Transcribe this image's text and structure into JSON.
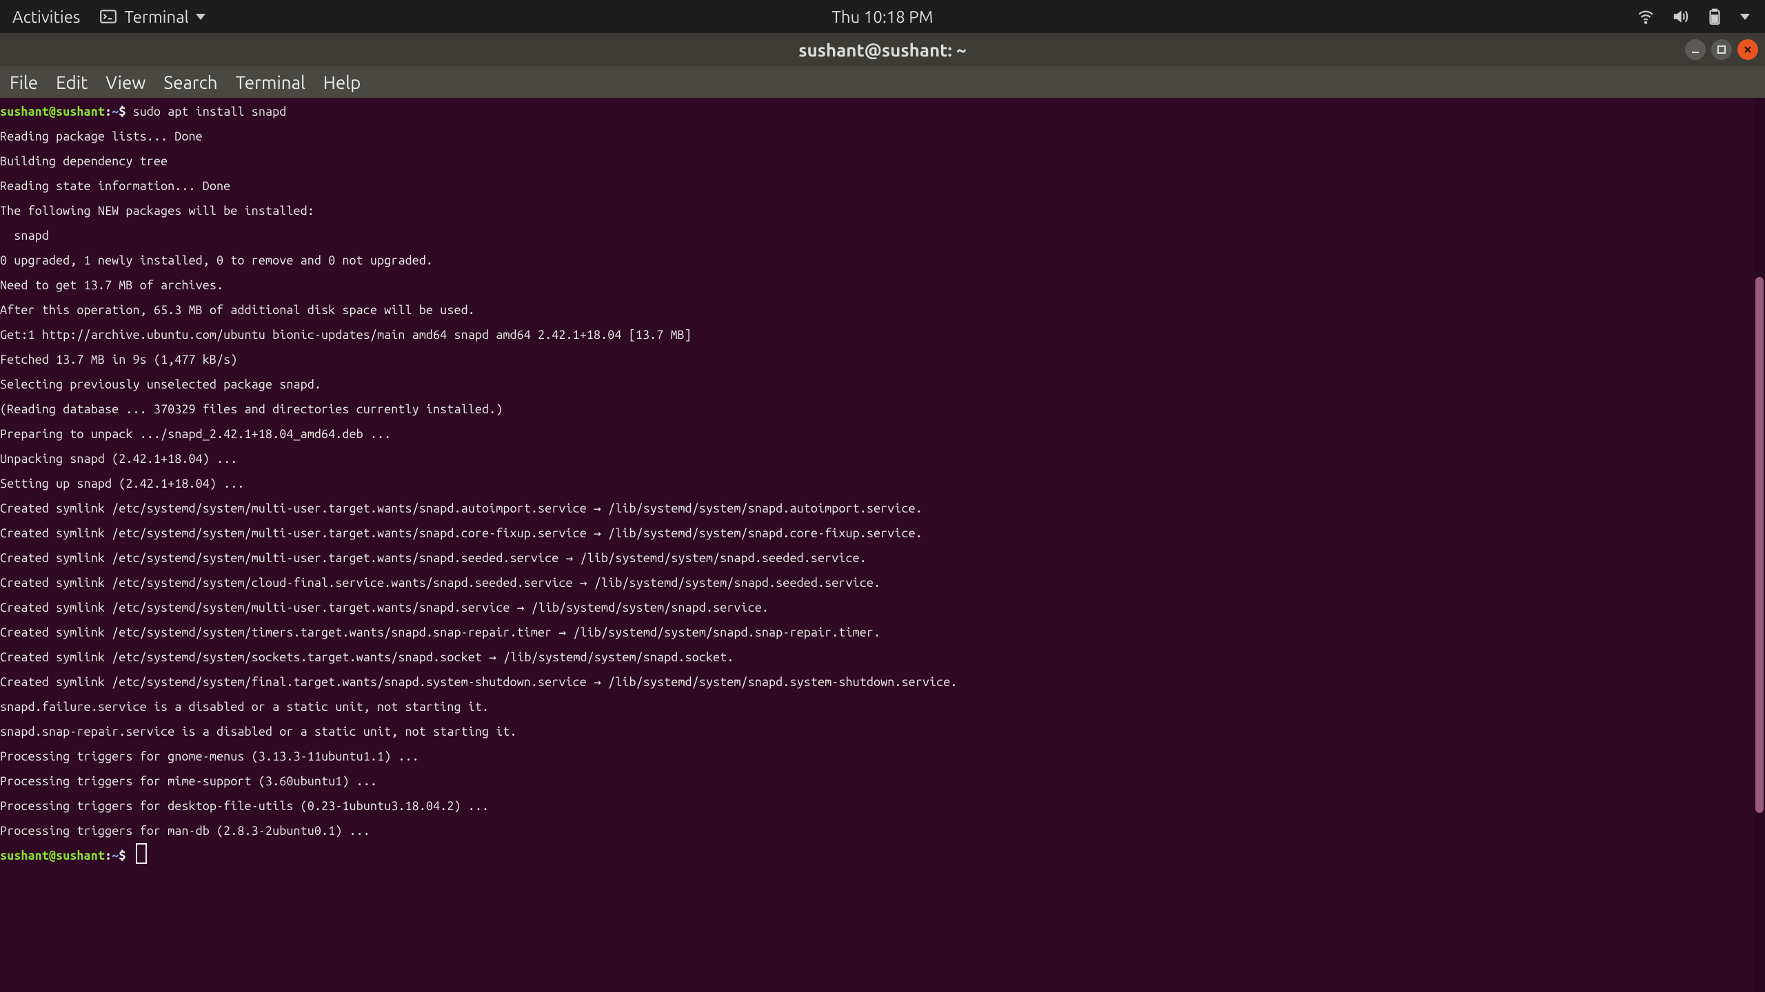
{
  "top_panel": {
    "activities": "Activities",
    "app_name": "Terminal",
    "clock": "Thu 10:18 PM",
    "icons": {
      "wifi": "wifi-icon",
      "volume": "volume-icon",
      "battery": "battery-icon",
      "dropdown": "chevron-down-icon",
      "terminal": "terminal-icon"
    }
  },
  "titlebar": {
    "title": "sushant@sushant: ~"
  },
  "menubar": {
    "items": [
      "File",
      "Edit",
      "View",
      "Search",
      "Terminal",
      "Help"
    ]
  },
  "prompt": {
    "userhost": "sushant@sushant",
    "sep": ":",
    "path": "~",
    "sigil": "$"
  },
  "command": "sudo apt install snapd",
  "output_lines": [
    "Reading package lists... Done",
    "Building dependency tree",
    "Reading state information... Done",
    "The following NEW packages will be installed:",
    "  snapd",
    "0 upgraded, 1 newly installed, 0 to remove and 0 not upgraded.",
    "Need to get 13.7 MB of archives.",
    "After this operation, 65.3 MB of additional disk space will be used.",
    "Get:1 http://archive.ubuntu.com/ubuntu bionic-updates/main amd64 snapd amd64 2.42.1+18.04 [13.7 MB]",
    "Fetched 13.7 MB in 9s (1,477 kB/s)",
    "Selecting previously unselected package snapd.",
    "(Reading database ... 370329 files and directories currently installed.)",
    "Preparing to unpack .../snapd_2.42.1+18.04_amd64.deb ...",
    "Unpacking snapd (2.42.1+18.04) ...",
    "Setting up snapd (2.42.1+18.04) ...",
    "Created symlink /etc/systemd/system/multi-user.target.wants/snapd.autoimport.service → /lib/systemd/system/snapd.autoimport.service.",
    "Created symlink /etc/systemd/system/multi-user.target.wants/snapd.core-fixup.service → /lib/systemd/system/snapd.core-fixup.service.",
    "Created symlink /etc/systemd/system/multi-user.target.wants/snapd.seeded.service → /lib/systemd/system/snapd.seeded.service.",
    "Created symlink /etc/systemd/system/cloud-final.service.wants/snapd.seeded.service → /lib/systemd/system/snapd.seeded.service.",
    "Created symlink /etc/systemd/system/multi-user.target.wants/snapd.service → /lib/systemd/system/snapd.service.",
    "Created symlink /etc/systemd/system/timers.target.wants/snapd.snap-repair.timer → /lib/systemd/system/snapd.snap-repair.timer.",
    "Created symlink /etc/systemd/system/sockets.target.wants/snapd.socket → /lib/systemd/system/snapd.socket.",
    "Created symlink /etc/systemd/system/final.target.wants/snapd.system-shutdown.service → /lib/systemd/system/snapd.system-shutdown.service.",
    "snapd.failure.service is a disabled or a static unit, not starting it.",
    "snapd.snap-repair.service is a disabled or a static unit, not starting it.",
    "Processing triggers for gnome-menus (3.13.3-11ubuntu1.1) ...",
    "Processing triggers for mime-support (3.60ubuntu1) ...",
    "Processing triggers for desktop-file-utils (0.23-1ubuntu3.18.04.2) ...",
    "Processing triggers for man-db (2.8.3-2ubuntu0.1) ..."
  ]
}
